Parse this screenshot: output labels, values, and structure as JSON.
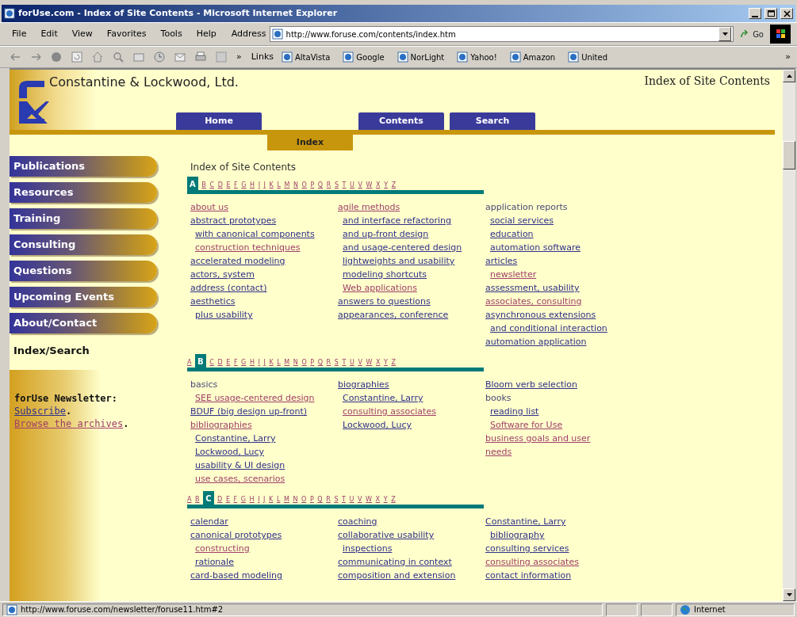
{
  "window": {
    "title": "forUse.com - Index of Site Contents - Microsoft Internet Explorer"
  },
  "menu": [
    "File",
    "Edit",
    "View",
    "Favorites",
    "Tools",
    "Help"
  ],
  "address": {
    "label": "Address",
    "value": "http://www.foruse.com/contents/index.htm"
  },
  "go_button": "Go",
  "toolbar_overflow": "»",
  "links_bar": {
    "label": "Links",
    "items": [
      "AltaVista",
      "Google",
      "NorLight",
      "Yahoo!",
      "Amazon",
      "United"
    ],
    "overflow": "»"
  },
  "page": {
    "company": "Constantine & Lockwood, Ltd.",
    "page_title": "Index of Site Contents",
    "top_tabs": [
      {
        "label": "Home"
      },
      {
        "label": "Contents"
      },
      {
        "label": "Search"
      }
    ],
    "sub_tab": "Index",
    "sidebar": {
      "items": [
        {
          "label": "Publications",
          "selected": false
        },
        {
          "label": "Resources",
          "selected": false
        },
        {
          "label": "Training",
          "selected": false
        },
        {
          "label": "Consulting",
          "selected": false
        },
        {
          "label": "Questions",
          "selected": false
        },
        {
          "label": "Upcoming Events",
          "selected": false
        },
        {
          "label": "About/Contact",
          "selected": false
        },
        {
          "label": "Index/Search",
          "selected": true
        }
      ]
    },
    "newsletter": [
      {
        "text": "forUse Newsletter",
        "kind": "bold",
        "after": ":"
      },
      {
        "text": "Subscribe",
        "kind": "link",
        "after": "."
      },
      {
        "text": "Browse the archives",
        "kind": "visited",
        "after": "."
      }
    ],
    "heading": "Index of Site Contents",
    "sections": [
      {
        "letters": [
          {
            "label": "A",
            "selected": true
          },
          {
            "label": "B",
            "selected": false
          },
          {
            "label": "C",
            "selected": false
          },
          {
            "label": "D",
            "selected": false
          },
          {
            "label": "E",
            "selected": false
          },
          {
            "label": "F",
            "selected": false
          },
          {
            "label": "G",
            "selected": false
          },
          {
            "label": "H",
            "selected": false
          },
          {
            "label": "I",
            "selected": false
          },
          {
            "label": "J",
            "selected": false
          },
          {
            "label": "K",
            "selected": false
          },
          {
            "label": "L",
            "selected": false
          },
          {
            "label": "M",
            "selected": false
          },
          {
            "label": "N",
            "selected": false
          },
          {
            "label": "O",
            "selected": false
          },
          {
            "label": "P",
            "selected": false
          },
          {
            "label": "Q",
            "selected": false
          },
          {
            "label": "R",
            "selected": false
          },
          {
            "label": "S",
            "selected": false
          },
          {
            "label": "T",
            "selected": false
          },
          {
            "label": "U",
            "selected": false
          },
          {
            "label": "V",
            "selected": false
          },
          {
            "label": "W",
            "selected": false
          },
          {
            "label": "X",
            "selected": false
          },
          {
            "label": "Y",
            "selected": false
          },
          {
            "label": "Z",
            "selected": false
          }
        ],
        "columns": [
          [
            {
              "text": "about us",
              "kind": "visited"
            },
            {
              "text": "abstract prototypes",
              "kind": "link",
              "children": [
                {
                  "text": "with canonical components",
                  "kind": "link"
                },
                {
                  "text": "construction techniques",
                  "kind": "visited"
                }
              ]
            },
            {
              "text": "accelerated modeling",
              "kind": "link"
            },
            {
              "text": "actors, system",
              "kind": "link"
            },
            {
              "text": "address (contact)",
              "kind": "link"
            },
            {
              "text": "aesthetics",
              "kind": "link",
              "children": [
                {
                  "text": "plus usability",
                  "kind": "link"
                }
              ]
            }
          ],
          [
            {
              "text": "agile methods",
              "kind": "visited",
              "children": [
                {
                  "text": "and interface refactoring",
                  "kind": "link"
                },
                {
                  "text": "and up-front design",
                  "kind": "link"
                },
                {
                  "text": "and usage-centered design",
                  "kind": "link"
                },
                {
                  "text": "lightweights and usability",
                  "kind": "link"
                },
                {
                  "text": "modeling shortcuts",
                  "kind": "link"
                },
                {
                  "text": "Web applications",
                  "kind": "visited"
                }
              ]
            },
            {
              "text": "answers to questions",
              "kind": "link"
            },
            {
              "text": "appearances, conference",
              "kind": "link"
            }
          ],
          [
            {
              "text": "application reports",
              "kind": "plain",
              "children": [
                {
                  "text": "social services",
                  "kind": "link"
                },
                {
                  "text": "education",
                  "kind": "link"
                },
                {
                  "text": "automation software",
                  "kind": "link"
                }
              ]
            },
            {
              "text": "articles",
              "kind": "link",
              "children": [
                {
                  "text": "newsletter",
                  "kind": "visited"
                }
              ]
            },
            {
              "text": "assessment, usability",
              "kind": "link"
            },
            {
              "text": "associates, consulting",
              "kind": "visited"
            },
            {
              "text": "asynchronous extensions",
              "kind": "link",
              "children": [
                {
                  "text": "and conditional interaction",
                  "kind": "link"
                }
              ]
            },
            {
              "text": "automation application",
              "kind": "link"
            }
          ]
        ]
      },
      {
        "letters": [
          {
            "label": "A",
            "selected": false
          },
          {
            "label": "B",
            "selected": true
          },
          {
            "label": "C",
            "selected": false
          },
          {
            "label": "D",
            "selected": false
          },
          {
            "label": "E",
            "selected": false
          },
          {
            "label": "F",
            "selected": false
          },
          {
            "label": "G",
            "selected": false
          },
          {
            "label": "H",
            "selected": false
          },
          {
            "label": "I",
            "selected": false
          },
          {
            "label": "J",
            "selected": false
          },
          {
            "label": "K",
            "selected": false
          },
          {
            "label": "L",
            "selected": false
          },
          {
            "label": "M",
            "selected": false
          },
          {
            "label": "N",
            "selected": false
          },
          {
            "label": "O",
            "selected": false
          },
          {
            "label": "P",
            "selected": false
          },
          {
            "label": "Q",
            "selected": false
          },
          {
            "label": "R",
            "selected": false
          },
          {
            "label": "S",
            "selected": false
          },
          {
            "label": "T",
            "selected": false
          },
          {
            "label": "U",
            "selected": false
          },
          {
            "label": "V",
            "selected": false
          },
          {
            "label": "W",
            "selected": false
          },
          {
            "label": "X",
            "selected": false
          },
          {
            "label": "Y",
            "selected": false
          },
          {
            "label": "Z",
            "selected": false
          }
        ],
        "columns": [
          [
            {
              "text": "basics",
              "kind": "plain",
              "children": [
                {
                  "text": "SEE usage-centered design",
                  "kind": "visited"
                }
              ]
            },
            {
              "text": "BDUF (big design up-front)",
              "kind": "link"
            },
            {
              "text": "bibliographies",
              "kind": "visited",
              "children": [
                {
                  "text": "Constantine, Larry",
                  "kind": "link"
                },
                {
                  "text": "Lockwood, Lucy",
                  "kind": "link"
                },
                {
                  "text": "usability & UI design",
                  "kind": "link"
                },
                {
                  "text": "use cases, scenarios",
                  "kind": "visited"
                }
              ]
            }
          ],
          [
            {
              "text": "biographies",
              "kind": "link",
              "children": [
                {
                  "text": "Constantine, Larry",
                  "kind": "link"
                },
                {
                  "text": "consulting associates",
                  "kind": "visited"
                },
                {
                  "text": "Lockwood, Lucy",
                  "kind": "link"
                }
              ]
            }
          ],
          [
            {
              "text": "Bloom verb selection",
              "kind": "link"
            },
            {
              "text": "books",
              "kind": "plain",
              "children": [
                {
                  "text": "reading list",
                  "kind": "link"
                },
                {
                  "text": "Software for Use",
                  "kind": "visited"
                }
              ]
            },
            {
              "text": "business goals and user",
              "kind": "visited"
            },
            {
              "text": "needs",
              "kind": "visited"
            }
          ]
        ]
      },
      {
        "letters": [
          {
            "label": "A",
            "selected": false
          },
          {
            "label": "B",
            "selected": false
          },
          {
            "label": "C",
            "selected": true
          },
          {
            "label": "D",
            "selected": false
          },
          {
            "label": "E",
            "selected": false
          },
          {
            "label": "F",
            "selected": false
          },
          {
            "label": "G",
            "selected": false
          },
          {
            "label": "H",
            "selected": false
          },
          {
            "label": "I",
            "selected": false
          },
          {
            "label": "J",
            "selected": false
          },
          {
            "label": "K",
            "selected": false
          },
          {
            "label": "L",
            "selected": false
          },
          {
            "label": "M",
            "selected": false
          },
          {
            "label": "N",
            "selected": false
          },
          {
            "label": "O",
            "selected": false
          },
          {
            "label": "P",
            "selected": false
          },
          {
            "label": "Q",
            "selected": false
          },
          {
            "label": "R",
            "selected": false
          },
          {
            "label": "S",
            "selected": false
          },
          {
            "label": "T",
            "selected": false
          },
          {
            "label": "U",
            "selected": false
          },
          {
            "label": "V",
            "selected": false
          },
          {
            "label": "W",
            "selected": false
          },
          {
            "label": "X",
            "selected": false
          },
          {
            "label": "Y",
            "selected": false
          },
          {
            "label": "Z",
            "selected": false
          }
        ],
        "columns": [
          [
            {
              "text": "calendar",
              "kind": "link"
            },
            {
              "text": "canonical prototypes",
              "kind": "link",
              "children": [
                {
                  "text": "constructing",
                  "kind": "visited"
                },
                {
                  "text": "rationale",
                  "kind": "link"
                }
              ]
            },
            {
              "text": "card-based modeling",
              "kind": "link"
            }
          ],
          [
            {
              "text": "coaching",
              "kind": "link"
            },
            {
              "text": "collaborative usability",
              "kind": "link",
              "children": [
                {
                  "text": "inspections",
                  "kind": "link"
                }
              ]
            },
            {
              "text": "communicating in context",
              "kind": "link"
            },
            {
              "text": "composition and extension",
              "kind": "link"
            }
          ],
          [
            {
              "text": "Constantine, Larry",
              "kind": "link",
              "children": [
                {
                  "text": "bibliography",
                  "kind": "link"
                }
              ]
            },
            {
              "text": "consulting services",
              "kind": "link"
            },
            {
              "text": "consulting associates",
              "kind": "visited"
            },
            {
              "text": "contact information",
              "kind": "link"
            }
          ]
        ]
      }
    ]
  },
  "status_bar": {
    "url": "http://www.foruse.com/newsletter/foruse11.htm#2",
    "zone": "Internet"
  }
}
